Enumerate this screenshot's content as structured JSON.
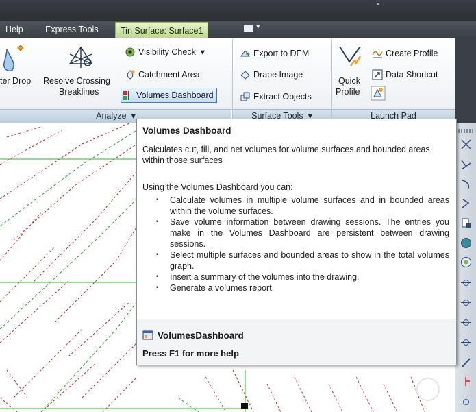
{
  "ribbon_tabs": {
    "help": "Help",
    "express_tools": "Express Tools",
    "tin_surface": "Tin Surface: Surface1"
  },
  "analyze_panel": {
    "water_drop_label": "ter Drop",
    "resolve_crossing_line1": "Resolve Crossing",
    "resolve_crossing_line2": "Breaklines",
    "visibility_check": "Visibility Check",
    "catchment_area": "Catchment Area",
    "volumes_dashboard": "Volumes Dashboard",
    "group_label": "Analyze"
  },
  "surface_tools_panel": {
    "export_to_dem": "Export to DEM",
    "drape_image": "Drape Image",
    "extract_objects": "Extract Objects",
    "group_label": "Surface Tools"
  },
  "launch_pad_panel": {
    "quick_profile_line1": "Quick",
    "quick_profile_line2": "Profile",
    "create_profile": "Create Profile",
    "data_shortcut": "Data Shortcut",
    "group_label": "Launch Pad"
  },
  "tooltip": {
    "title": "Volumes Dashboard",
    "description": "Calculates cut, fill, and net volumes for volume surfaces and bounded areas within those surfaces",
    "intro": "Using the Volumes Dashboard you can:",
    "bullets": [
      "Calculate volumes in multiple volume surfaces and in bounded areas within the volume surfaces.",
      "Save volume information between drawing sessions. The entries you make in the Volumes Dashboard are persistent between drawing sessions.",
      "Select multiple surfaces and bounded areas to show in the total volumes graph.",
      "Insert a summary of the volumes into the drawing.",
      "Generate a volumes report."
    ],
    "command": "VolumesDashboard",
    "help": "Press F1 for more help"
  },
  "icons": {
    "water_drop": "water-drop-icon",
    "resolve_crossing": "resolve-crossing-breaklines-icon",
    "visibility_check": "visibility-check-icon",
    "catchment_area": "catchment-area-icon",
    "volumes_dashboard": "volumes-dashboard-icon",
    "export_to_dem": "export-to-dem-icon",
    "drape_image": "drape-image-icon",
    "extract_objects": "extract-objects-icon",
    "quick_profile": "quick-profile-icon",
    "create_profile": "create-profile-icon",
    "data_shortcut": "data-shortcut-icon"
  },
  "colors": {
    "active_tab": "#c9e2a3",
    "contour_red": "#cc2222",
    "contour_green": "#22aa22",
    "selection_border": "#3f7cc4"
  }
}
